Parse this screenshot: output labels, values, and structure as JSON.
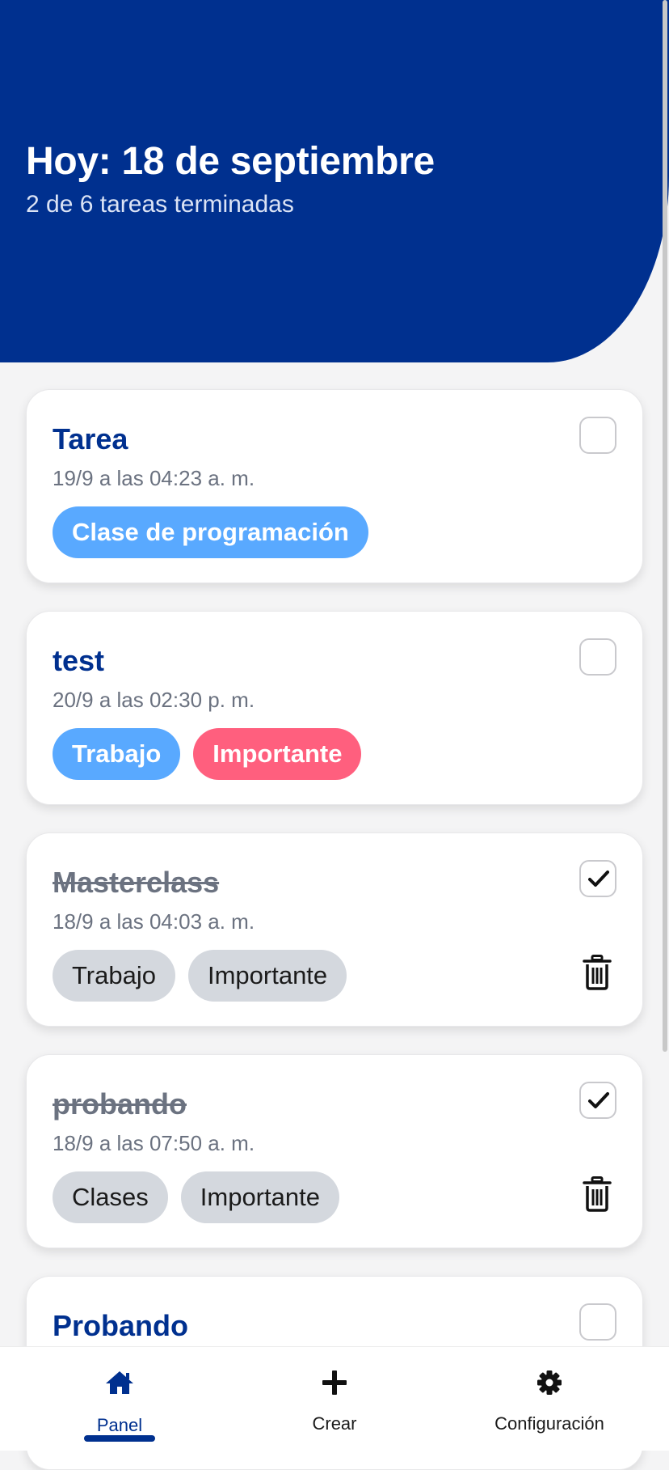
{
  "header": {
    "title": "Hoy: 18 de septiembre",
    "subtitle": "2 de 6 tareas terminadas"
  },
  "tasks": [
    {
      "title": "Tarea",
      "date": "19/9 a las 04:23 a. m.",
      "done": false,
      "tags": [
        {
          "label": "Clase de programación",
          "color": "blue"
        }
      ]
    },
    {
      "title": "test",
      "date": "20/9 a las 02:30 p. m.",
      "done": false,
      "tags": [
        {
          "label": "Trabajo",
          "color": "blue"
        },
        {
          "label": "Importante",
          "color": "pink"
        }
      ]
    },
    {
      "title": "Masterclass",
      "date": "18/9 a las 04:03 a. m.",
      "done": true,
      "tags": [
        {
          "label": "Trabajo",
          "color": "gray"
        },
        {
          "label": "Importante",
          "color": "gray"
        }
      ]
    },
    {
      "title": "probando",
      "date": "18/9 a las 07:50 a. m.",
      "done": true,
      "tags": [
        {
          "label": "Clases",
          "color": "gray"
        },
        {
          "label": "Importante",
          "color": "gray"
        }
      ]
    },
    {
      "title": "Probando",
      "done": false
    }
  ],
  "nav": {
    "items": [
      {
        "label": "Panel",
        "icon": "home-icon",
        "active": true
      },
      {
        "label": "Crear",
        "icon": "plus-icon",
        "active": false
      },
      {
        "label": "Configuración",
        "icon": "gear-icon",
        "active": false
      }
    ]
  },
  "colors": {
    "primary": "#00308f",
    "tag_blue": "#59a9ff",
    "tag_pink": "#ff5f7e",
    "tag_gray": "#d4d8de",
    "background": "#f4f4f5"
  }
}
